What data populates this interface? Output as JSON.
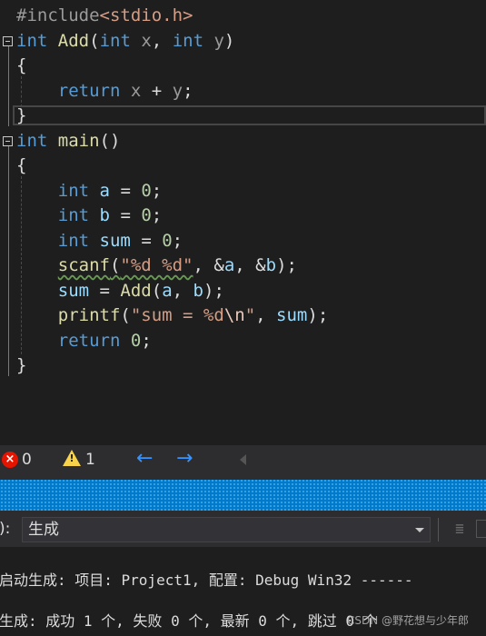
{
  "editor": {
    "lines": [
      {
        "t": "#include<stdio.h>"
      },
      {
        "t": "int Add(int x, int y)"
      },
      {
        "t": "{"
      },
      {
        "t": "    return x + y;"
      },
      {
        "t": "}"
      },
      {
        "t": "int main()"
      },
      {
        "t": "{"
      },
      {
        "t": "    int a = 0;"
      },
      {
        "t": "    int b = 0;"
      },
      {
        "t": "    int sum = 0;"
      },
      {
        "t": "    scanf(\"%d %d\", &a, &b);"
      },
      {
        "t": "    sum = Add(a, b);"
      },
      {
        "t": "    printf(\"sum = %d\\n\", sum);"
      },
      {
        "t": "    return 0;"
      },
      {
        "t": "}"
      }
    ]
  },
  "status": {
    "errors": "0",
    "warnings": "1",
    "back_arrow": "←",
    "forward_arrow": "→"
  },
  "output": {
    "source_label": "):",
    "source_value": "生成",
    "line1": "启动生成: 项目: Project1, 配置: Debug Win32 ------",
    "line2": "生成: 成功 1 个, 失败 0 个, 最新 0 个, 跳过 0 个",
    "watermark": "CSDN @野花想与少年郎"
  },
  "colors": {
    "keyword": "#569cd6",
    "function": "#dcdcaa",
    "variable": "#9cdcfe",
    "number": "#b5cea8",
    "string": "#d69d85",
    "accent_bar": "#007acc"
  }
}
